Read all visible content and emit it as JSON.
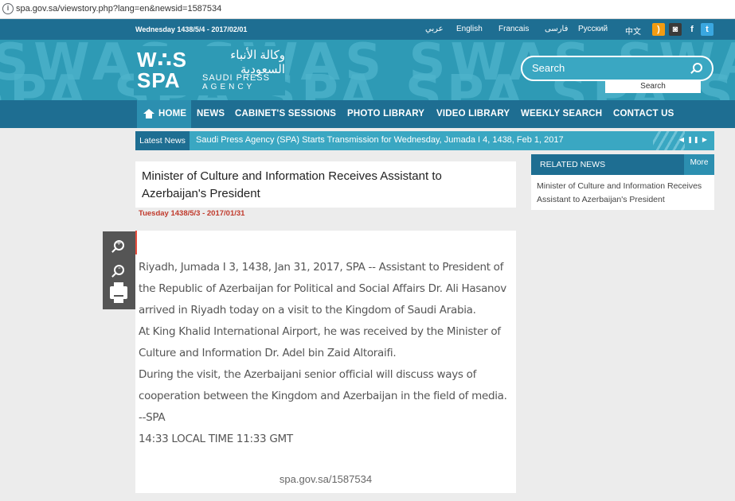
{
  "browser": {
    "url": "spa.gov.sa/viewstory.php?lang=en&newsid=1587534"
  },
  "top_strip": {
    "date": "Wednesday 1438/5/4 - 2017/02/01",
    "languages": [
      "عربي",
      "English",
      "Francais",
      "فارسی",
      "Русский",
      "中文"
    ],
    "social_icons": [
      "rss-icon",
      "instagram-icon",
      "facebook-icon",
      "twitter-icon"
    ]
  },
  "header": {
    "logo_mark": "WAS SPA",
    "logo_arabic": "وكالة الأنباء السعودية",
    "logo_en_line1": "SAUDI PRESS",
    "logo_en_line2": "AGENCY",
    "search_placeholder": "Search",
    "search_button": "Search"
  },
  "nav": {
    "items": [
      "HOME",
      "NEWS",
      "CABINET'S SESSIONS",
      "PHOTO LIBRARY",
      "VIDEO LIBRARY",
      "WEEKLY SEARCH",
      "CONTACT US"
    ]
  },
  "ticker": {
    "label": "Latest News",
    "text": "Saudi Press Agency (SPA) Starts Transmission for Wednesday, Jumada I 4, 1438, Feb 1, 2017",
    "controls": "◀ ❚❚ ▶"
  },
  "article": {
    "title": "Minister of Culture and Information Receives Assistant to Azerbaijan's President",
    "date": "Tuesday 1438/5/3 - 2017/01/31",
    "paragraphs": [
      "Riyadh, Jumada I 3, 1438, Jan 31, 2017, SPA -- Assistant to President of the Republic of Azerbaijan for Political and Social Affairs Dr. Ali Hasanov arrived in Riyadh today on a visit to the Kingdom of Saudi Arabia.",
      "At King Khalid International Airport, he was received by the Minister of Culture and Information Dr. Adel bin Zaid Altoraifi.",
      "During the visit, the Azerbaijani senior official will discuss ways of cooperation between the Kingdom and Azerbaijan in the field of media.",
      "--SPA",
      "14:33 LOCAL TIME 11:33 GMT"
    ],
    "footer_link": "spa.gov.sa/1587534"
  },
  "related": {
    "title": "RELATED NEWS",
    "more": "More",
    "item": "Minister of Culture and Information Receives Assistant to Azerbaijan's President"
  },
  "colors": {
    "dark_blue": "#1e6e92",
    "banner_teal": "#2e9ab5",
    "date_red": "#c0392b"
  }
}
